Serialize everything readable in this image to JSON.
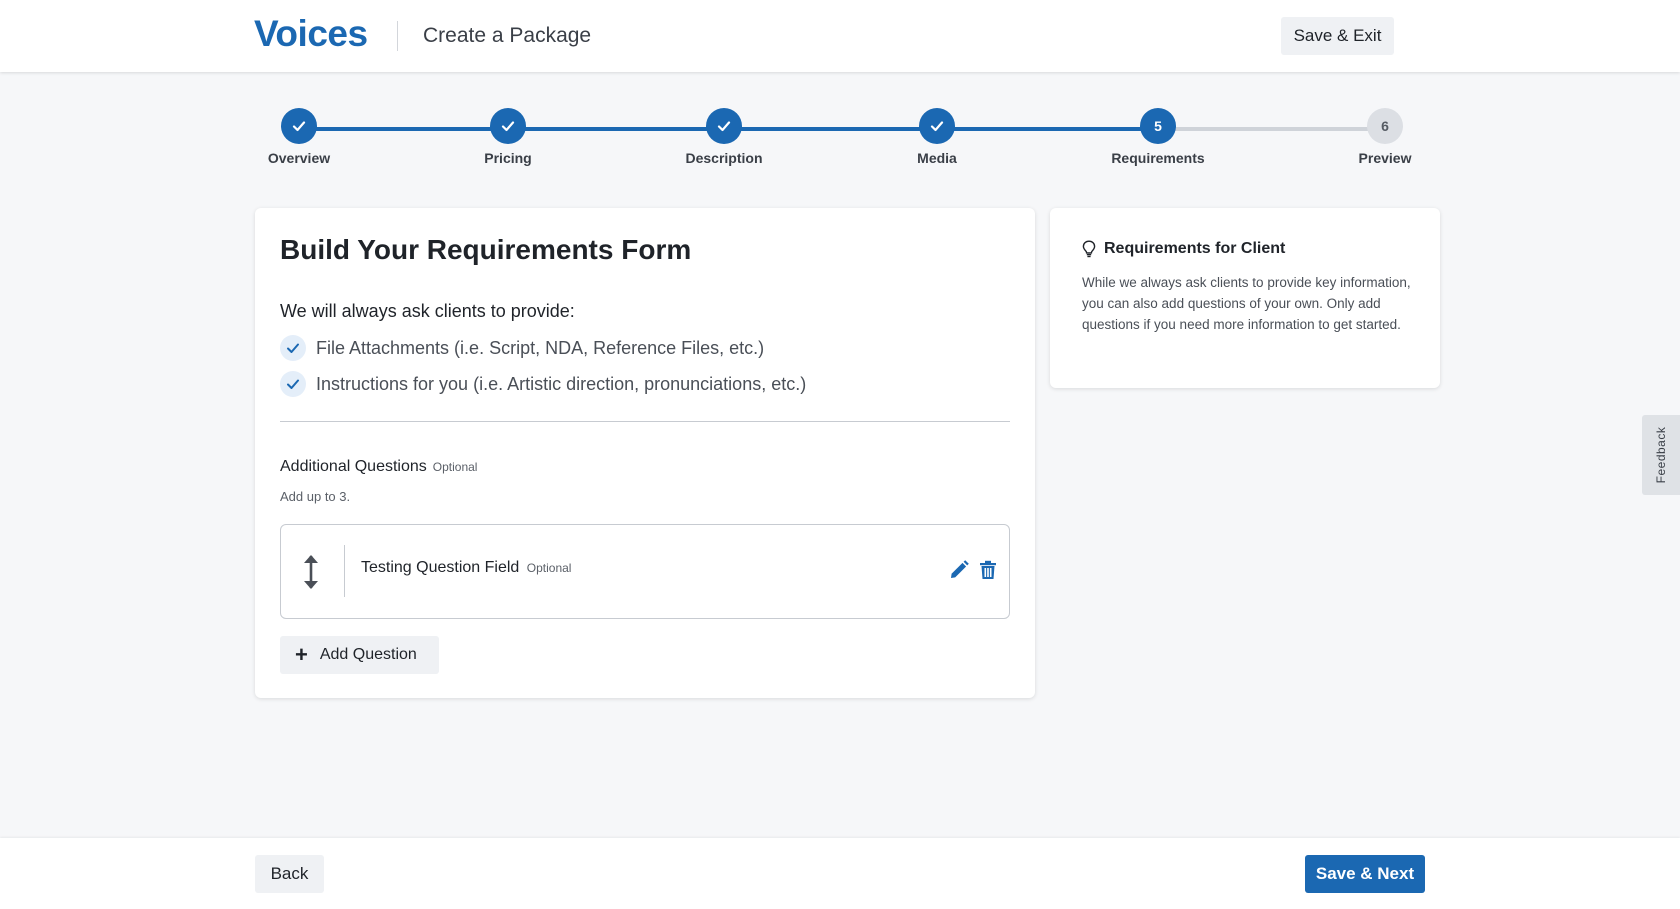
{
  "header": {
    "logo": "Voices",
    "title": "Create a Package",
    "save_exit": "Save & Exit"
  },
  "stepper": {
    "steps": [
      {
        "label": "Overview",
        "number": "1",
        "state": "done"
      },
      {
        "label": "Pricing",
        "number": "2",
        "state": "done"
      },
      {
        "label": "Description",
        "number": "3",
        "state": "done"
      },
      {
        "label": "Media",
        "number": "4",
        "state": "done"
      },
      {
        "label": "Requirements",
        "number": "5",
        "state": "current"
      },
      {
        "label": "Preview",
        "number": "6",
        "state": "todo"
      }
    ]
  },
  "main": {
    "title": "Build Your Requirements Form",
    "always_intro": "We will always ask clients to provide:",
    "always_items": [
      "File Attachments (i.e. Script, NDA, Reference Files, etc.)",
      "Instructions for you (i.e. Artistic direction, pronunciations, etc.)"
    ],
    "additional": {
      "title": "Additional Questions",
      "optional": "Optional",
      "subtitle": "Add up to 3."
    },
    "questions": [
      {
        "label": "Testing Question Field",
        "optional": "Optional"
      }
    ],
    "add_question": "Add Question"
  },
  "side": {
    "title": "Requirements for Client",
    "body": "While we always ask clients to provide key information, you can also add questions of your own. Only add questions if you need more information to get started."
  },
  "feedback": "Feedback",
  "footer": {
    "back": "Back",
    "next": "Save & Next"
  },
  "colors": {
    "brand": "#1b68b2",
    "page_bg": "#f6f7f9"
  }
}
